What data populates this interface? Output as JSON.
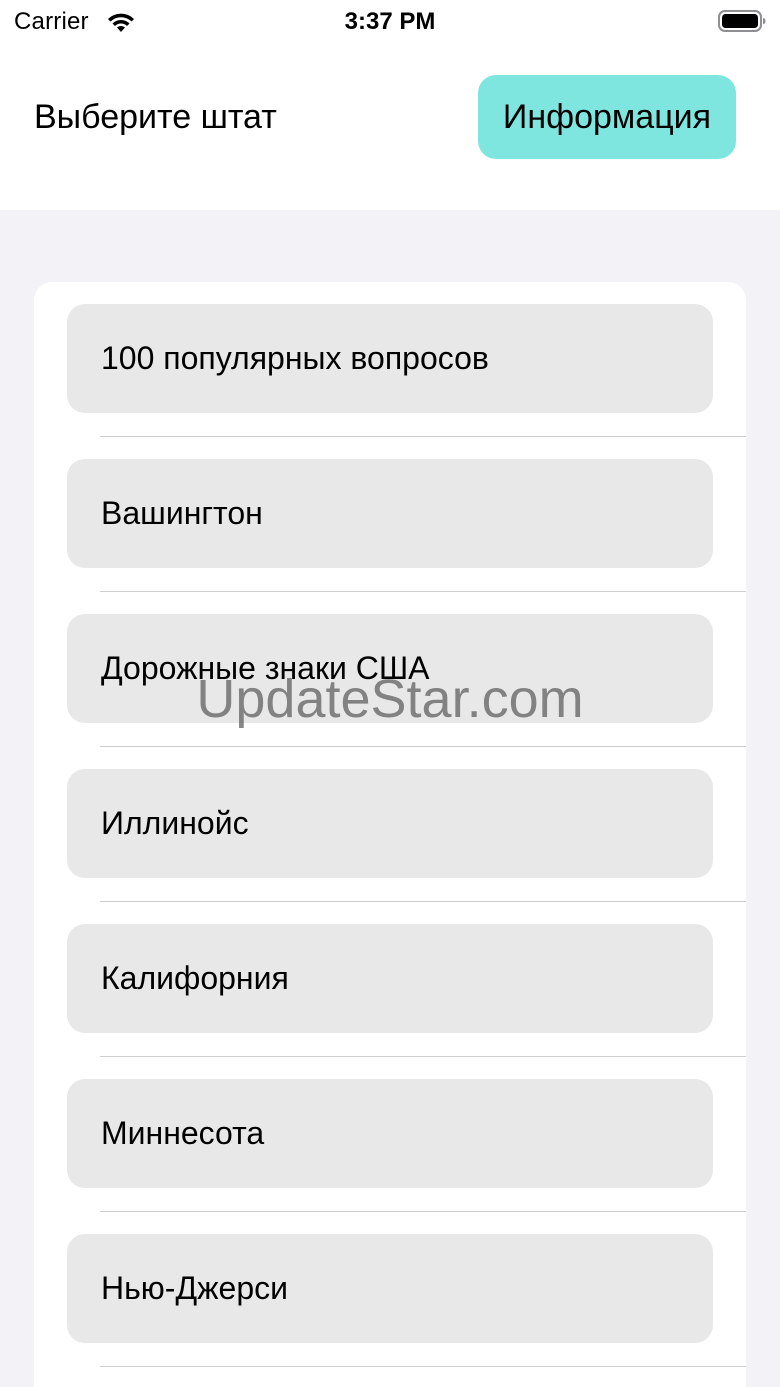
{
  "status_bar": {
    "carrier": "Carrier",
    "time": "3:37 PM"
  },
  "header": {
    "title": "Выберите штат",
    "info_button": "Информация",
    "accent_color": "#7ee6df"
  },
  "list": {
    "items": [
      {
        "label": "100 популярных вопросов"
      },
      {
        "label": "Вашингтон"
      },
      {
        "label": "Дорожные знаки США"
      },
      {
        "label": "Иллинойс"
      },
      {
        "label": "Калифорния"
      },
      {
        "label": "Миннесота"
      },
      {
        "label": "Нью-Джерси"
      }
    ]
  },
  "watermark": "UpdateStar.com",
  "icons": {
    "wifi": "wifi-icon",
    "battery": "battery-icon"
  }
}
